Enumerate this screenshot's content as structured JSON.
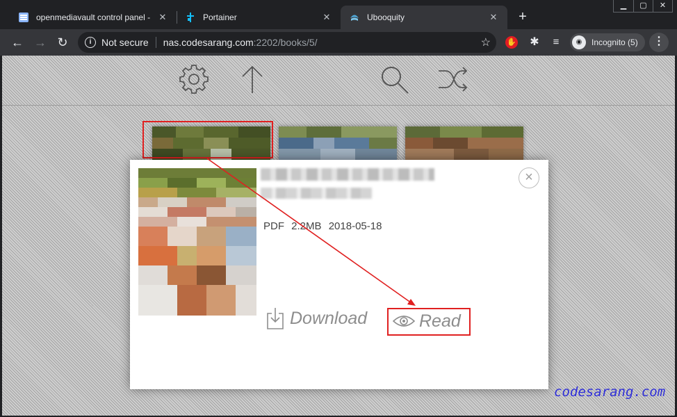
{
  "tabs": [
    {
      "title": "openmediavault control panel - N",
      "close": "✕"
    },
    {
      "title": "Portainer",
      "close": "✕"
    },
    {
      "title": "Ubooquity",
      "close": "✕"
    }
  ],
  "new_tab": "+",
  "window_controls": {
    "minimize": "▁",
    "maximize": "▢",
    "close": "✕"
  },
  "nav": {
    "back": "←",
    "forward": "→",
    "reload": "↻"
  },
  "omnibox": {
    "security": "Not secure",
    "host": "nas.codesarang.com",
    "path": ":2202/books/5/",
    "star": "☆"
  },
  "extensions": {
    "red_ext": "✋",
    "puzzle": "✱",
    "media": "≡"
  },
  "profile": {
    "label": "Incognito (5)",
    "avatar": "◉"
  },
  "menu": "⋮",
  "page_icons": [
    "settings-icon",
    "up-arrow-icon",
    "search-icon",
    "shuffle-icon"
  ],
  "book": {
    "format": "PDF",
    "size": "2.2MB",
    "date": "2018-05-18",
    "download_label": "Download",
    "read_label": "Read",
    "close": "×"
  },
  "watermark": "codesarang.com",
  "colors": {
    "annotation": "#e02020",
    "watermark": "#2f2fd8",
    "chrome_dark": "#202124",
    "chrome_mid": "#35363a"
  }
}
